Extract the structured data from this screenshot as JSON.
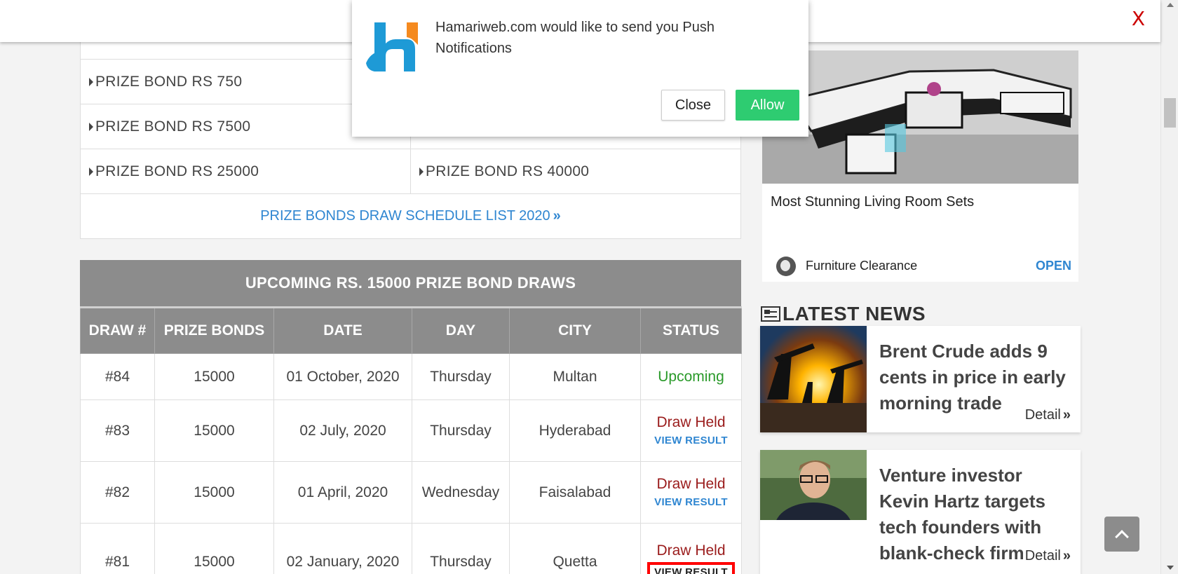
{
  "topbar": {
    "close_label": "X"
  },
  "notification": {
    "message": "Hamariweb.com would like to send you Push Notifications",
    "close_label": "Close",
    "allow_label": "Allow",
    "colors": {
      "allow": "#2ecc71",
      "logo_blue": "#1e9ad6",
      "logo_orange": "#f58a1f"
    }
  },
  "bond_links": {
    "rows": [
      [
        "PRIZE BOND RS 750",
        ""
      ],
      [
        "PRIZE BOND RS 7500",
        ""
      ],
      [
        "PRIZE BOND RS 25000",
        "PRIZE BOND RS 40000"
      ]
    ],
    "schedule_link": "PRIZE BONDS DRAW SCHEDULE LIST 2020"
  },
  "draws": {
    "title": "UPCOMING RS. 15000 PRIZE BOND DRAWS",
    "headers": [
      "DRAW #",
      "PRIZE BONDS",
      "DATE",
      "DAY",
      "CITY",
      "STATUS"
    ],
    "rows": [
      {
        "draw": "#84",
        "bond": "15000",
        "date": "01 October, 2020",
        "day": "Thursday",
        "city": "Multan",
        "status": "Upcoming",
        "link": ""
      },
      {
        "draw": "#83",
        "bond": "15000",
        "date": "02 July, 2020",
        "day": "Thursday",
        "city": "Hyderabad",
        "status": "Draw Held",
        "link": "VIEW RESULT"
      },
      {
        "draw": "#82",
        "bond": "15000",
        "date": "01 April, 2020",
        "day": "Wednesday",
        "city": "Faisalabad",
        "status": "Draw Held",
        "link": "VIEW RESULT"
      },
      {
        "draw": "#81",
        "bond": "15000",
        "date": "02 January, 2020",
        "day": "Thursday",
        "city": "Quetta",
        "status": "Draw Held",
        "link": "VIEW RESULT"
      }
    ]
  },
  "ad": {
    "title": "Most Stunning Living Room Sets",
    "brand": "Furniture Clearance",
    "cta": "OPEN"
  },
  "news": {
    "heading": "LATEST NEWS",
    "items": [
      {
        "headline": "Brent Crude adds 9 cents in price in early morning trade",
        "detail": "Detail"
      },
      {
        "headline": "Venture investor Kevin Hartz targets tech founders with blank-check firm",
        "detail": "Detail"
      }
    ]
  }
}
